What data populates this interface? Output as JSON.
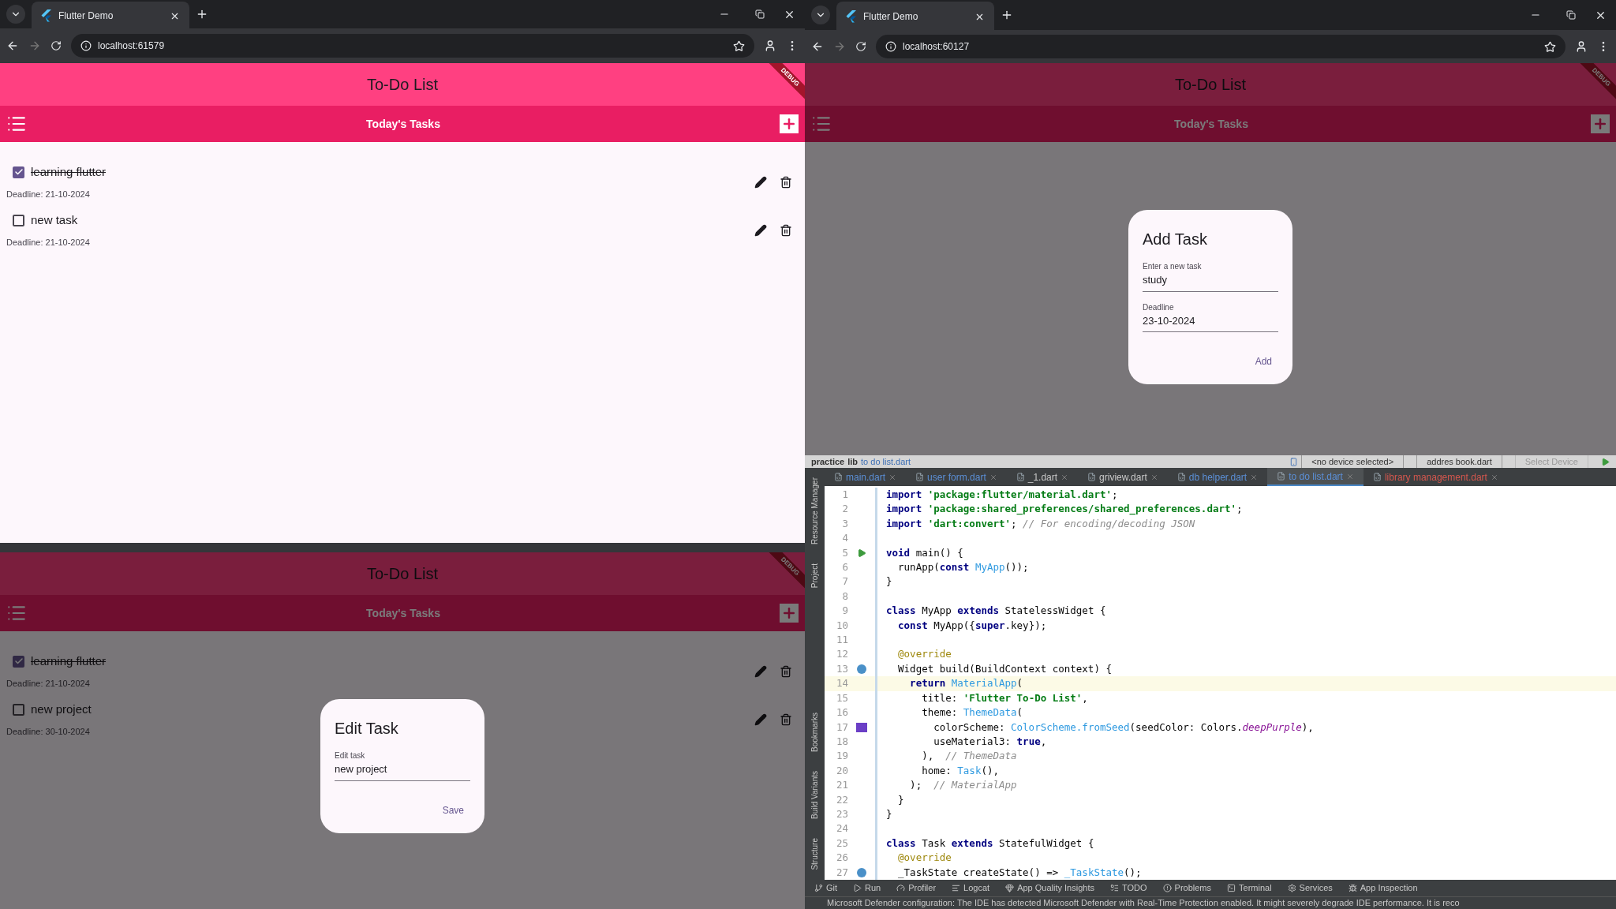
{
  "top_left_browser": {
    "tab_title": "Flutter Demo",
    "url": "localhost:61579",
    "app": {
      "title": "To-Do List",
      "banner": "DEBUG",
      "subtitle": "Today's Tasks",
      "tasks": [
        {
          "title": "learning flutter",
          "checked": true,
          "deadline": "Deadline: 21-10-2024"
        },
        {
          "title": "new task",
          "checked": false,
          "deadline": "Deadline: 21-10-2024"
        }
      ]
    }
  },
  "top_right_browser": {
    "tab_title": "Flutter Demo",
    "url": "localhost:60127",
    "app": {
      "title": "To-Do List",
      "banner": "DEBUG",
      "subtitle": "Today's Tasks",
      "dialog": {
        "title": "Add Task",
        "fields": [
          {
            "label": "Enter a new task",
            "value": "study"
          },
          {
            "label": "Deadline",
            "value": "23-10-2024"
          }
        ],
        "action": "Add"
      }
    }
  },
  "bottom_left_browser": {
    "app": {
      "title": "To-Do List",
      "banner": "DEBUG",
      "subtitle": "Today's Tasks",
      "tasks": [
        {
          "title": "learning flutter",
          "checked": true,
          "deadline": "Deadline: 21-10-2024"
        },
        {
          "title": "new project",
          "checked": false,
          "deadline": "Deadline: 30-10-2024"
        }
      ],
      "dialog": {
        "title": "Edit Task",
        "fields": [
          {
            "label": "Edit task",
            "value": "new project"
          }
        ],
        "action": "Save"
      }
    }
  },
  "ide": {
    "breadcrumb": [
      "practice",
      "lib",
      "to do list.dart"
    ],
    "device_selector": "<no device selected>",
    "config_selector": "addres book.dart",
    "target_selector": "Select Device",
    "tabs": [
      {
        "label": "main.dart",
        "selected": false,
        "kind": "modified"
      },
      {
        "label": "user form.dart",
        "selected": false,
        "kind": "modified"
      },
      {
        "label": "_1.dart",
        "selected": false,
        "kind": "unchanged"
      },
      {
        "label": "griview.dart",
        "selected": false,
        "kind": "unchanged"
      },
      {
        "label": "db helper.dart",
        "selected": false,
        "kind": "modified"
      },
      {
        "label": "to do list.dart",
        "selected": true,
        "kind": "modified"
      },
      {
        "label": "library management.dart",
        "selected": false,
        "kind": "error"
      }
    ],
    "side_tools": {
      "top": [
        "Resource Manager",
        "Project"
      ],
      "bottom": [
        "Bookmarks",
        "Build Variants",
        "Structure"
      ]
    },
    "lines": [
      {
        "number": "1",
        "current": false,
        "kind": "plain",
        "tokens": [
          {
            "text": "import",
            "kind": "keyword"
          },
          {
            "text": " 'package:flutter/material.dart'",
            "kind": "string"
          },
          {
            "text": ";",
            "kind": "plain"
          }
        ]
      },
      {
        "number": "2",
        "current": false,
        "kind": "plain",
        "tokens": [
          {
            "text": "import",
            "kind": "keyword"
          },
          {
            "text": " 'package:shared_preferences/shared_preferences.dart'",
            "kind": "string"
          },
          {
            "text": ";",
            "kind": "plain"
          }
        ]
      },
      {
        "number": "3",
        "current": false,
        "kind": "plain",
        "tokens": [
          {
            "text": "import",
            "kind": "keyword"
          },
          {
            "text": " 'dart:convert'",
            "kind": "string"
          },
          {
            "text": ";",
            "kind": "plain"
          },
          {
            "text": " // For encoding/decoding JSON",
            "kind": "comment"
          }
        ]
      },
      {
        "number": "4",
        "current": false,
        "kind": "plain"
      },
      {
        "number": "5",
        "current": false,
        "kind": "run",
        "tokens": [
          {
            "text": "void",
            "kind": "keyword"
          },
          {
            "text": " main() {",
            "kind": "plain"
          }
        ]
      },
      {
        "number": "6",
        "current": false,
        "kind": "plain",
        "tokens": [
          {
            "text": "  runApp(",
            "kind": "plain"
          },
          {
            "text": "const",
            "kind": "keyword"
          },
          {
            "text": " MyApp",
            "kind": "type"
          },
          {
            "text": "());",
            "kind": "plain"
          }
        ]
      },
      {
        "number": "7",
        "current": false,
        "kind": "plain",
        "tokens": [
          {
            "text": "}",
            "kind": "plain"
          }
        ]
      },
      {
        "number": "8",
        "current": false,
        "kind": "plain"
      },
      {
        "number": "9",
        "current": false,
        "kind": "plain",
        "tokens": [
          {
            "text": "class",
            "kind": "keyword"
          },
          {
            "text": " MyApp ",
            "kind": "plain"
          },
          {
            "text": "extends",
            "kind": "keyword"
          },
          {
            "text": " StatelessWidget {",
            "kind": "plain"
          }
        ]
      },
      {
        "number": "10",
        "current": false,
        "kind": "plain",
        "tokens": [
          {
            "text": "  const",
            "kind": "keyword"
          },
          {
            "text": " MyApp({",
            "kind": "plain"
          },
          {
            "text": "super",
            "kind": "keyword"
          },
          {
            "text": ".key});",
            "kind": "plain"
          }
        ]
      },
      {
        "number": "11",
        "current": false,
        "kind": "plain"
      },
      {
        "number": "12",
        "current": false,
        "kind": "plain",
        "tokens": [
          {
            "text": "  @override",
            "kind": "annotation"
          }
        ]
      },
      {
        "number": "13",
        "current": false,
        "kind": "override",
        "tokens": [
          {
            "text": "  Widget build(BuildContext context) {",
            "kind": "plain"
          }
        ]
      },
      {
        "number": "14",
        "current": true,
        "kind": "plain",
        "tokens": [
          {
            "text": "    return",
            "kind": "keyword"
          },
          {
            "text": " MaterialApp",
            "kind": "type"
          },
          {
            "text": "(",
            "kind": "plain"
          }
        ]
      },
      {
        "number": "15",
        "current": false,
        "kind": "plain",
        "tokens": [
          {
            "text": "      title: ",
            "kind": "plain"
          },
          {
            "text": "'Flutter To-Do List'",
            "kind": "string"
          },
          {
            "text": ",",
            "kind": "plain"
          }
        ]
      },
      {
        "number": "16",
        "current": false,
        "kind": "plain",
        "tokens": [
          {
            "text": "      theme: ",
            "kind": "plain"
          },
          {
            "text": "ThemeData",
            "kind": "type"
          },
          {
            "text": "(",
            "kind": "plain"
          }
        ]
      },
      {
        "number": "17",
        "current": false,
        "kind": "swatch",
        "color": "#6b3fc6",
        "tokens": [
          {
            "text": "        colorScheme: ",
            "kind": "plain"
          },
          {
            "text": "ColorScheme.fromSeed",
            "kind": "type"
          },
          {
            "text": "(seedColor: Colors.",
            "kind": "plain"
          },
          {
            "text": "deepPurple",
            "kind": "italic"
          },
          {
            "text": "),",
            "kind": "plain"
          }
        ]
      },
      {
        "number": "18",
        "current": false,
        "kind": "plain",
        "tokens": [
          {
            "text": "        useMaterial3: ",
            "kind": "plain"
          },
          {
            "text": "true",
            "kind": "keyword"
          },
          {
            "text": ",",
            "kind": "plain"
          }
        ]
      },
      {
        "number": "19",
        "current": false,
        "kind": "plain",
        "tokens": [
          {
            "text": "      ),  ",
            "kind": "plain"
          },
          {
            "text": "// ThemeData",
            "kind": "comment"
          }
        ]
      },
      {
        "number": "20",
        "current": false,
        "kind": "plain",
        "tokens": [
          {
            "text": "      home: ",
            "kind": "plain"
          },
          {
            "text": "Task",
            "kind": "type"
          },
          {
            "text": "(),",
            "kind": "plain"
          }
        ]
      },
      {
        "number": "21",
        "current": false,
        "kind": "plain",
        "tokens": [
          {
            "text": "    );  ",
            "kind": "plain"
          },
          {
            "text": "// MaterialApp",
            "kind": "comment"
          }
        ]
      },
      {
        "number": "22",
        "current": false,
        "kind": "plain",
        "tokens": [
          {
            "text": "  }",
            "kind": "plain"
          }
        ]
      },
      {
        "number": "23",
        "current": false,
        "kind": "plain",
        "tokens": [
          {
            "text": "}",
            "kind": "plain"
          }
        ]
      },
      {
        "number": "24",
        "current": false,
        "kind": "plain"
      },
      {
        "number": "25",
        "current": false,
        "kind": "plain",
        "tokens": [
          {
            "text": "class",
            "kind": "keyword"
          },
          {
            "text": " Task ",
            "kind": "plain"
          },
          {
            "text": "extends",
            "kind": "keyword"
          },
          {
            "text": " StatefulWidget {",
            "kind": "plain"
          }
        ]
      },
      {
        "number": "26",
        "current": false,
        "kind": "plain",
        "tokens": [
          {
            "text": "  @override",
            "kind": "annotation"
          }
        ]
      },
      {
        "number": "27",
        "current": false,
        "kind": "override",
        "tokens": [
          {
            "text": "  _TaskState createState() => ",
            "kind": "plain"
          },
          {
            "text": "_TaskState",
            "kind": "type"
          },
          {
            "text": "();",
            "kind": "plain"
          }
        ]
      }
    ],
    "tool_windows": [
      "Git",
      "Run",
      "Profiler",
      "Logcat",
      "App Quality Insights",
      "TODO",
      "Problems",
      "Terminal",
      "Services",
      "App Inspection"
    ],
    "status": "Microsoft Defender configuration: The IDE has detected Microsoft Defender with Real-Time Protection enabled. It might severely degrade IDE performance. It is reco"
  }
}
